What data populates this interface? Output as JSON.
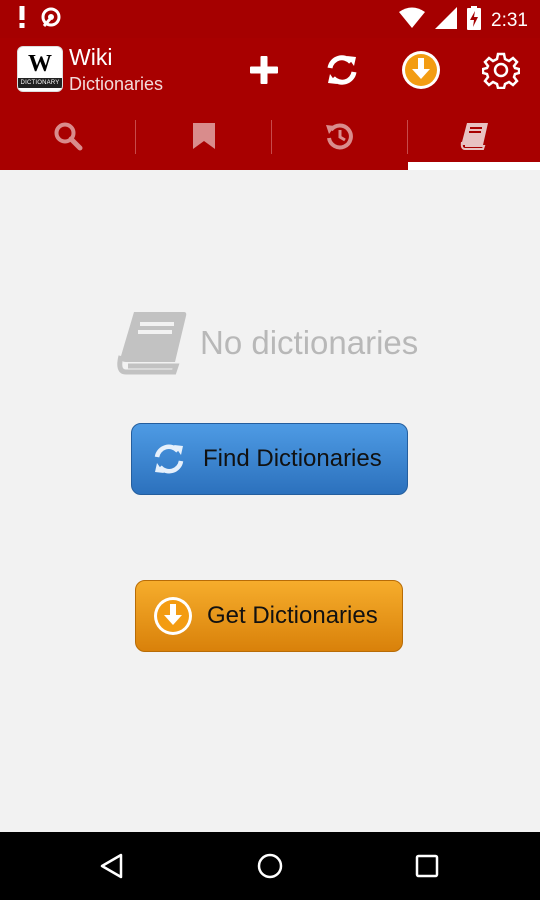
{
  "status_bar": {
    "time": "2:31",
    "left_icons": [
      "notification-alert-icon",
      "debug-icon"
    ],
    "right_icons": [
      "wifi-icon",
      "signal-icon",
      "battery-charging-icon"
    ]
  },
  "app_bar": {
    "logo_text": "W",
    "logo_strip": "DICTIONARY",
    "title": "Wiki",
    "subtitle": "Dictionaries",
    "actions": [
      {
        "name": "add",
        "icon": "plus-icon"
      },
      {
        "name": "refresh",
        "icon": "refresh-icon"
      },
      {
        "name": "download",
        "icon": "download-icon"
      },
      {
        "name": "settings",
        "icon": "gear-icon"
      }
    ]
  },
  "tabs": [
    {
      "name": "search",
      "icon": "search-icon",
      "selected": false
    },
    {
      "name": "bookmarks",
      "icon": "bookmark-icon",
      "selected": false
    },
    {
      "name": "history",
      "icon": "history-icon",
      "selected": false
    },
    {
      "name": "dictionaries",
      "icon": "book-icon",
      "selected": true
    }
  ],
  "main": {
    "empty_message": "No dictionaries",
    "find_button": "Find Dictionaries",
    "get_button": "Get Dictionaries"
  },
  "colors": {
    "primary": "#a80000",
    "status_bar": "#a50000",
    "find_button": "#3a86d4",
    "get_button": "#ee9a1c",
    "download_accent": "#f39c12"
  },
  "nav_bar": {
    "buttons": [
      "back",
      "home",
      "recents"
    ]
  }
}
